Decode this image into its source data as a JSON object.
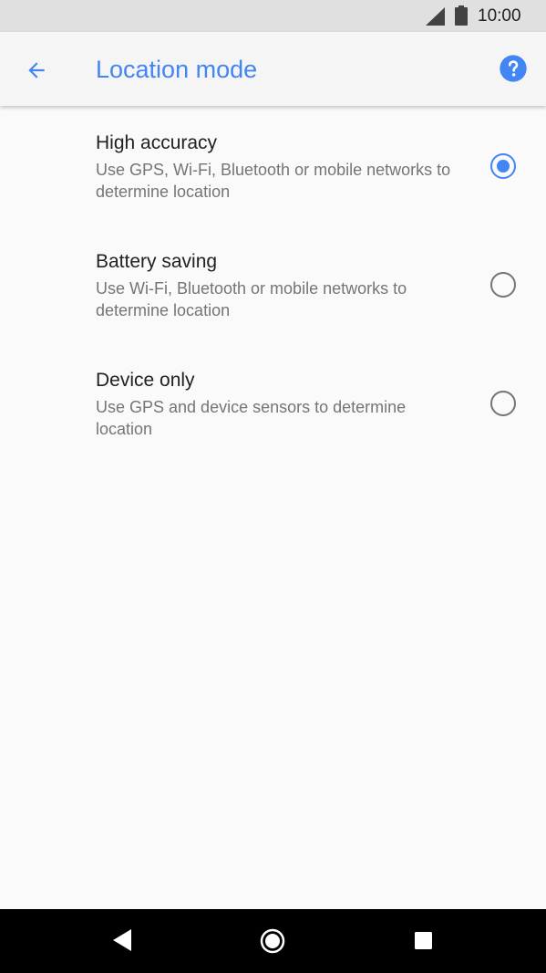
{
  "status_bar": {
    "time": "10:00",
    "icons": [
      "cellular-signal-icon",
      "battery-icon"
    ]
  },
  "app_bar": {
    "title": "Location mode",
    "back_icon": "arrow-back-icon",
    "help_icon": "help-circle-icon"
  },
  "options": [
    {
      "title": "High accuracy",
      "description": "Use GPS, Wi-Fi, Bluetooth or mobile networks to determine location",
      "selected": true
    },
    {
      "title": "Battery saving",
      "description": "Use Wi-Fi, Bluetooth or mobile networks to determine location",
      "selected": false
    },
    {
      "title": "Device only",
      "description": "Use GPS and device sensors to determine location",
      "selected": false
    }
  ],
  "nav_bar": {
    "icons": [
      "nav-back-icon",
      "nav-home-icon",
      "nav-recents-icon"
    ]
  },
  "colors": {
    "accent": "#4285f4",
    "status_bar_bg": "#e0e0e0",
    "app_bar_bg": "#f5f5f5",
    "background": "#fafafa",
    "primary_text": "#212121",
    "secondary_text": "#757575",
    "nav_bar_bg": "#000000"
  }
}
